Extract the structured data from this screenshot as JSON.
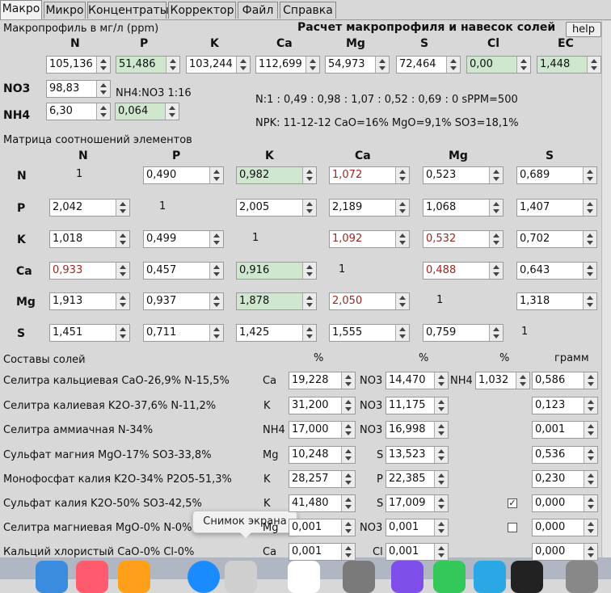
{
  "tabs": [
    {
      "label": "Макро",
      "active": true
    },
    {
      "label": "Микро"
    },
    {
      "label": "Концентраты"
    },
    {
      "label": "Корректор"
    },
    {
      "label": "Файл"
    },
    {
      "label": "Справка"
    }
  ],
  "macro": {
    "units_label": "Макропрофиль в мг/л (ppm)",
    "title": "Расчет макропрофиля и навесок солей",
    "help_label": "help",
    "headers": [
      "N",
      "P",
      "K",
      "Ca",
      "Mg",
      "S",
      "Cl",
      "EC"
    ],
    "values": [
      "105,136",
      "51,486",
      "103,244",
      "112,699",
      "54,973",
      "72,464",
      "0,00",
      "1,448"
    ],
    "no3_label": "NO3",
    "no3_value": "98,83",
    "nh4_label": "NH4",
    "nh4_value": "6,30",
    "ratio_label": "NH4:NO3 1:16",
    "ratio_value": "0,064",
    "summary1": "N:1 : 0,49 : 0,98 : 1,07 : 0,52 : 0,69 : 0 sPPM=500",
    "summary2": "NPK: 11-12-12 CaO=16% MgO=9,1% SO3=18,1%"
  },
  "matrix": {
    "title": "Матрица соотношений элементов",
    "cols": [
      "N",
      "P",
      "K",
      "Ca",
      "Mg",
      "S"
    ],
    "rows": [
      {
        "label": "N",
        "cells": [
          "1",
          "0,490",
          "0,982",
          "1,072",
          "0,523",
          "0,689"
        ]
      },
      {
        "label": "P",
        "cells": [
          "2,042",
          "1",
          "2,005",
          "2,189",
          "1,068",
          "1,407"
        ]
      },
      {
        "label": "K",
        "cells": [
          "1,018",
          "0,499",
          "1",
          "1,092",
          "0,532",
          "0,702"
        ]
      },
      {
        "label": "Ca",
        "cells": [
          "0,933",
          "0,457",
          "0,916",
          "1",
          "0,488",
          "0,643"
        ]
      },
      {
        "label": "Mg",
        "cells": [
          "1,913",
          "0,937",
          "1,878",
          "2,050",
          "1",
          "1,318"
        ]
      },
      {
        "label": "S",
        "cells": [
          "1,451",
          "0,711",
          "1,425",
          "1,555",
          "0,759",
          "1"
        ]
      }
    ]
  },
  "salts": {
    "title": "Составы солей",
    "pct1": "%",
    "pct2": "%",
    "pct3": "%",
    "gram": "грамм",
    "rows": [
      {
        "name": "Селитра кальциевая CaO-26,9% N-15,5%",
        "e1": "Ca",
        "v1": "19,228",
        "e2": "NO3",
        "v2": "14,470",
        "e3": "NH4",
        "v3": "1,032",
        "g": "0,586"
      },
      {
        "name": "Селитра калиевая K2O-37,6% N-11,2%",
        "e1": "K",
        "v1": "31,200",
        "e2": "NO3",
        "v2": "11,175",
        "g": "0,123"
      },
      {
        "name": "Селитра аммиачная N-34%",
        "e1": "NH4",
        "v1": "17,000",
        "e2": "NO3",
        "v2": "16,998",
        "g": "0,001"
      },
      {
        "name": "Сульфат магния MgO-17% SO3-33,8%",
        "e1": "Mg",
        "v1": "10,248",
        "e2": "S",
        "v2": "13,523",
        "g": "0,536"
      },
      {
        "name": "Монофосфат калия K2O-34% P2O5-51,3%",
        "e1": "K",
        "v1": "28,257",
        "e2": "P",
        "v2": "22,385",
        "g": "0,230"
      },
      {
        "name": "Сульфат калия K2O-50% SO3-42,5%",
        "e1": "K",
        "v1": "41,480",
        "e2": "S",
        "v2": "17,009",
        "check": "✓",
        "g": "0,000"
      },
      {
        "name": "Селитра магниевая MgO-0% N-0%",
        "e1": "Mg",
        "v1": "0,001",
        "e2": "NO3",
        "v2": "0,001",
        "check": "",
        "g": "0,000"
      },
      {
        "name": "Кальций хлористый CaO-0% Cl-0%",
        "e1": "Ca",
        "v1": "0,001",
        "e2": "Cl",
        "v2": "0,001",
        "g": "0,000"
      }
    ]
  },
  "tooltip": "Снимок экрана",
  "colors": {
    "green_field": "#cfe6cf",
    "red_value": "#a1261c"
  },
  "dock_icons": [
    "finder-icon",
    "music-icon",
    "books-icon",
    "app-store-icon",
    "screenshot-icon",
    "photos-icon",
    "system-preferences-icon",
    "viber-icon",
    "phone-icon",
    "telegram-icon",
    "hotspot-icon",
    "trash-icon"
  ]
}
